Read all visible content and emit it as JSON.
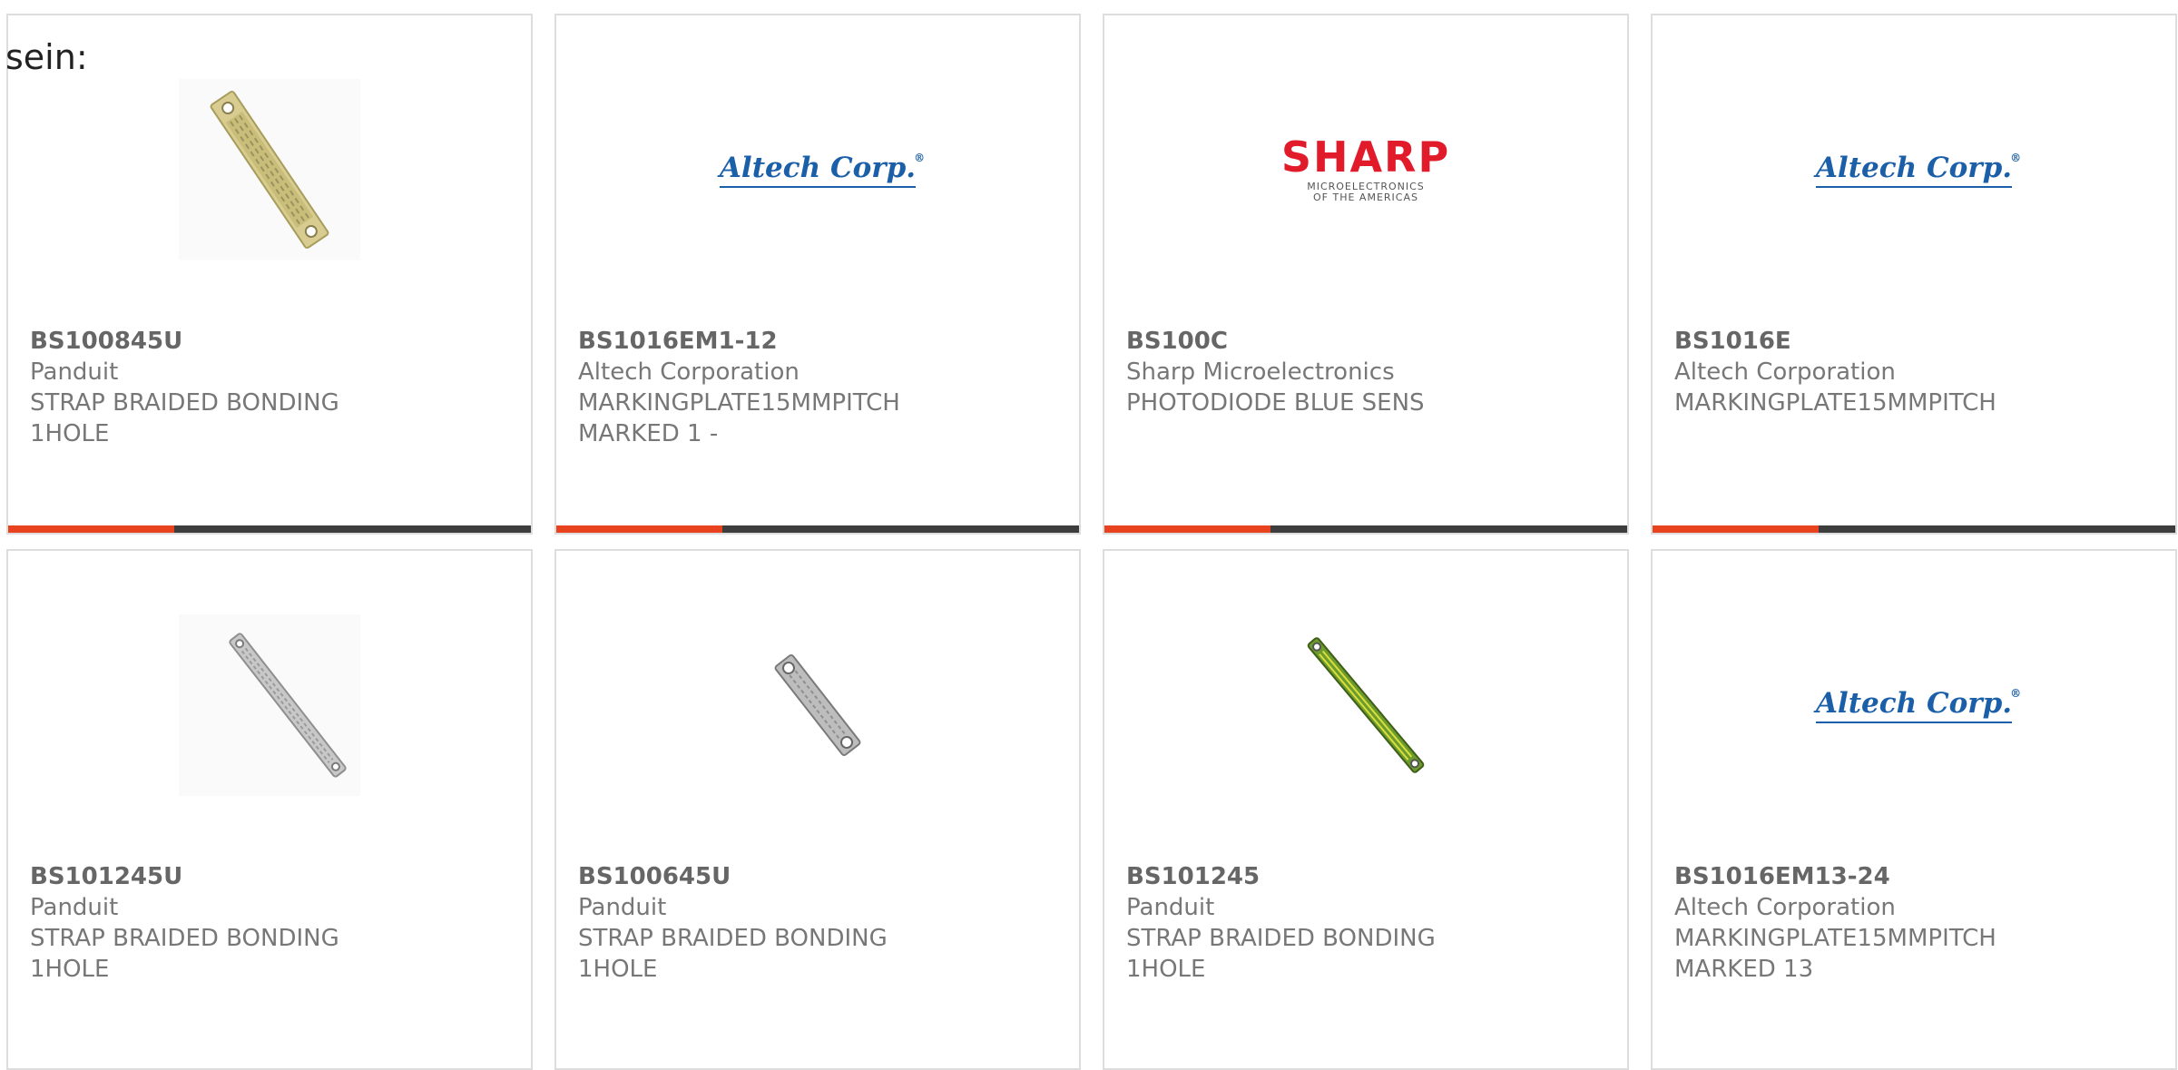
{
  "page_label": "sein:",
  "colors": {
    "accent": "#e8421e",
    "bar": "#3d3d3d",
    "text": "#777777",
    "altech_blue": "#1a5fa8",
    "sharp_red": "#e21b2b"
  },
  "cards": [
    {
      "part_number": "BS100845U",
      "manufacturer": "Panduit",
      "desc1": "STRAP BRAIDED BONDING",
      "desc2": "1HOLE",
      "image": "braided-strap-gold"
    },
    {
      "part_number": "BS1016EM1-12",
      "manufacturer": "Altech Corporation",
      "desc1": "MARKINGPLATE15MMPITCH",
      "desc2": "MARKED 1 -",
      "image": "altech-logo",
      "logo_text": "Altech Corp.",
      "logo_reg": "®"
    },
    {
      "part_number": "BS100C",
      "manufacturer": "Sharp Microelectronics",
      "desc1": "PHOTODIODE BLUE SENS",
      "desc2": "",
      "image": "sharp-logo",
      "logo_text": "SHARP",
      "logo_sub1": "MICROELECTRONICS",
      "logo_sub2": "OF THE AMERICAS"
    },
    {
      "part_number": "BS1016E",
      "manufacturer": "Altech Corporation",
      "desc1": "MARKINGPLATE15MMPITCH",
      "desc2": "",
      "image": "altech-logo",
      "logo_text": "Altech Corp.",
      "logo_reg": "®"
    },
    {
      "part_number": "BS101245U",
      "manufacturer": "Panduit",
      "desc1": "STRAP BRAIDED BONDING",
      "desc2": "1HOLE",
      "image": "braided-strap-silver-long"
    },
    {
      "part_number": "BS100645U",
      "manufacturer": "Panduit",
      "desc1": "STRAP BRAIDED BONDING",
      "desc2": "1HOLE",
      "image": "braided-strap-silver-short"
    },
    {
      "part_number": "BS101245",
      "manufacturer": "Panduit",
      "desc1": "STRAP BRAIDED BONDING",
      "desc2": "1HOLE",
      "image": "braided-strap-green-yellow"
    },
    {
      "part_number": "BS1016EM13-24",
      "manufacturer": "Altech Corporation",
      "desc1": "MARKINGPLATE15MMPITCH",
      "desc2": "MARKED 13",
      "image": "altech-logo",
      "logo_text": "Altech Corp.",
      "logo_reg": "®"
    }
  ]
}
